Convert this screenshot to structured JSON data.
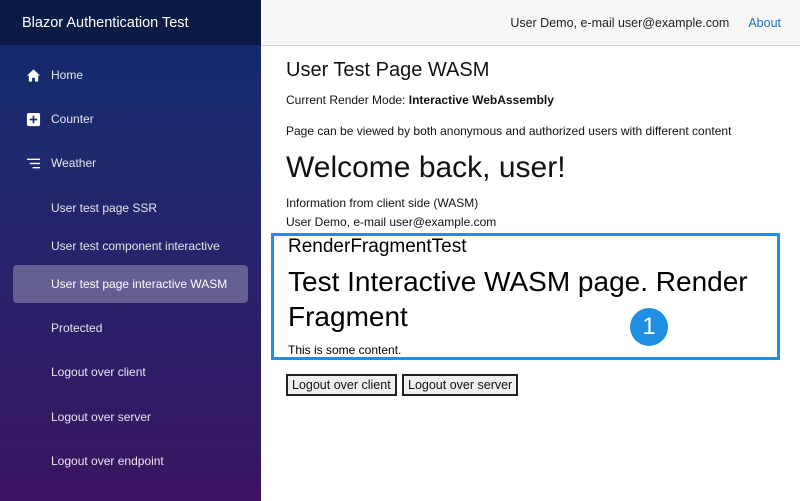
{
  "sidebar": {
    "brand": "Blazor Authentication Test",
    "items": [
      {
        "label": "Home",
        "icon": "home-icon"
      },
      {
        "label": "Counter",
        "icon": "plus-square-icon"
      },
      {
        "label": "Weather",
        "icon": "list-icon"
      },
      {
        "label": "User test page SSR"
      },
      {
        "label": "User test component interactive"
      },
      {
        "label": "User test page interactive WASM",
        "active": true
      },
      {
        "label": "Protected"
      },
      {
        "label": "Logout over client"
      },
      {
        "label": "Logout over server"
      },
      {
        "label": "Logout over endpoint"
      }
    ]
  },
  "topbar": {
    "user": "User Demo, e-mail user@example.com",
    "about": "About"
  },
  "main": {
    "title": "User Test Page WASM",
    "render_mode_label": "Current Render Mode: ",
    "render_mode_value": "Interactive WebAssembly",
    "description": "Page can be viewed by both anonymous and authorized users with different content",
    "welcome": "Welcome back, user!",
    "client_info": "Information from client side (WASM)",
    "client_user": "User Demo, e-mail user@example.com",
    "fragment": {
      "title": "RenderFragmentTest",
      "heading": "Test Interactive WASM page. Render Fragment",
      "content": "This is some content."
    },
    "buttons": {
      "logout_client": "Logout over client",
      "logout_server": "Logout over server"
    }
  },
  "annotation": {
    "badge": "1"
  },
  "colors": {
    "accent": "#1e8fe3",
    "link": "#1b6ec2",
    "sidebar_top": "#0d2a6b",
    "sidebar_bottom": "#3a1461"
  }
}
